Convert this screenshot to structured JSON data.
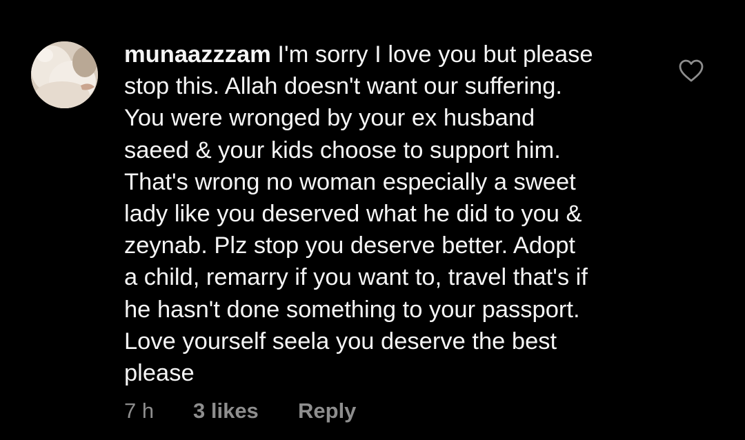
{
  "comment": {
    "username": "munaazzzam",
    "text_lines": [
      " I'm sorry I love you but please",
      "stop this. Allah doesn't want our suffering.",
      "You were wronged by your ex husband",
      "saeed & your kids choose to support him.",
      "That's wrong no woman especially a sweet",
      "lady like you deserved what he did to you &",
      "zeynab. Plz stop you deserve better. Adopt",
      "a child, remarry if you want to, travel that's if",
      "he hasn't done something to your passport.",
      "Love yourself seela you deserve the best",
      "please"
    ],
    "timestamp": "7 h",
    "likes": "3 likes",
    "reply_label": "Reply",
    "avatar_icon": "user-avatar-photo",
    "like_icon": "heart-outline-icon"
  },
  "colors": {
    "background": "#000000",
    "text": "#f5f5f5",
    "meta": "#8e8e8e"
  }
}
